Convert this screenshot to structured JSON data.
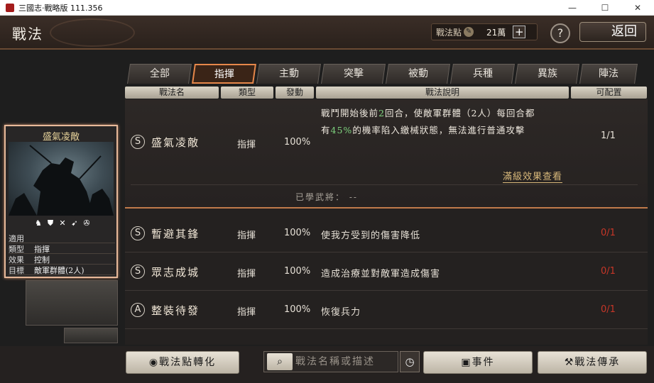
{
  "window": {
    "title": "三國志·戰略版 111.356",
    "controls": [
      "—",
      "☐",
      "✕"
    ]
  },
  "header": {
    "title": "戰法",
    "points_label": "戰法點",
    "points_value": "21萬",
    "plus": "+",
    "help": "?",
    "back_label": "返回"
  },
  "tabs": [
    {
      "label": "全部",
      "active": false
    },
    {
      "label": "指揮",
      "active": true
    },
    {
      "label": "主動",
      "active": false
    },
    {
      "label": "突擊",
      "active": false
    },
    {
      "label": "被動",
      "active": false
    },
    {
      "label": "兵種",
      "active": false
    },
    {
      "label": "異族",
      "active": false
    },
    {
      "label": "陣法",
      "active": false
    }
  ],
  "columns": [
    "戰法名",
    "類型",
    "發動",
    "戰法說明",
    "可配置"
  ],
  "card": {
    "name": "盛氣凌敵",
    "rows": [
      {
        "k": "適用",
        "v": ""
      },
      {
        "k": "類型",
        "v": "指揮"
      },
      {
        "k": "效果",
        "v": "控制"
      },
      {
        "k": "目標",
        "v": "敵軍群體(2人)"
      }
    ]
  },
  "selected": {
    "grade": "S",
    "name": "盛氣凌敵",
    "type": "指揮",
    "rate": "100%",
    "desc_line1_a": "戰鬥開始後前",
    "desc_line1_num": "2",
    "desc_line1_b": "回合，使敵軍群體（2人）每回合都",
    "desc_line2_a": "有",
    "desc_line2_pct": "45%",
    "desc_line2_b": "的機率陷入繳械狀態，無法進行普通攻擊",
    "count": "1/1",
    "full_effect_link": "滿級效果查看",
    "learned": "已學武將：  --"
  },
  "rows": [
    {
      "grade": "S",
      "name": "暫避其鋒",
      "type": "指揮",
      "rate": "100%",
      "desc": "使我方受到的傷害降低",
      "count": "0/1"
    },
    {
      "grade": "S",
      "name": "眾志成城",
      "type": "指揮",
      "rate": "100%",
      "desc": "造成治療並對敵軍造成傷害",
      "count": "0/1"
    },
    {
      "grade": "A",
      "name": "整裝待發",
      "type": "指揮",
      "rate": "100%",
      "desc": "恢復兵力",
      "count": "0/1"
    }
  ],
  "bottom": {
    "convert_label": "戰法點轉化",
    "search_placeholder": "戰法名稱或描述",
    "event_label": "事件",
    "inherit_label": "戰法傳承"
  }
}
